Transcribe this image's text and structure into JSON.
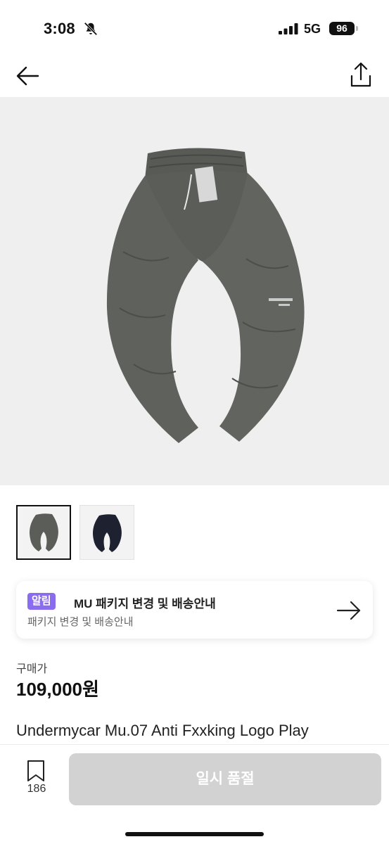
{
  "status_bar": {
    "time": "3:08",
    "network": "5G",
    "battery": "96",
    "bell_icon": "bell-slash-icon",
    "signal_icon": "signal-bars-icon"
  },
  "nav": {
    "back_icon": "arrow-left-icon",
    "share_icon": "share-upload-icon"
  },
  "gallery": {
    "thumbnails": [
      {
        "color": "#5a5d58",
        "selected": true
      },
      {
        "color": "#1d2130",
        "selected": false
      }
    ]
  },
  "notice": {
    "badge": "알림",
    "title": "MU 패키지 변경 및 배송안내",
    "subtitle": "패키지 변경 및 배송안내",
    "arrow_icon": "arrow-right-icon"
  },
  "price": {
    "label": "구매가",
    "value": "109,000원"
  },
  "product": {
    "title": "Undermycar Mu.07 Anti Fxxking Logo Play"
  },
  "bottom": {
    "bookmark_icon": "bookmark-icon",
    "bookmark_count": "186",
    "sold_out_label": "일시 품절"
  },
  "colors": {
    "accent_badge": "#8a6cf0",
    "disabled_button": "#d2d2d2",
    "pants_primary": "#5a5d58",
    "pants_secondary": "#1d2130"
  }
}
